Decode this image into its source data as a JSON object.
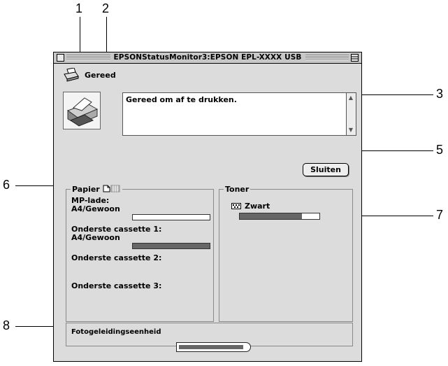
{
  "callouts": [
    "1",
    "2",
    "3",
    "5",
    "6",
    "7",
    "8"
  ],
  "window": {
    "title": "EPSONStatusMonitor3:EPSON EPL-XXXX USB"
  },
  "status": {
    "heading": "Gereed",
    "message": "Gereed om af te drukken."
  },
  "close_button": "Sluiten",
  "paper": {
    "group_label": "Papier",
    "trays": [
      {
        "name": "MP-lade:",
        "media": "A4/Gewoon",
        "level": 0.0
      },
      {
        "name": "Onderste cassette 1:",
        "media": "A4/Gewoon",
        "level": 1.0
      },
      {
        "name": "Onderste cassette 2:",
        "media": "",
        "level": null
      },
      {
        "name": "Onderste cassette 3:",
        "media": "",
        "level": null
      }
    ]
  },
  "toner": {
    "group_label": "Toner",
    "color_name": "Zwart",
    "level": 0.78
  },
  "photoconductor": {
    "label": "Fotogeleidingseenheid",
    "level": 0.95
  },
  "colors": {
    "window_bg": "#dcdcdc",
    "bar_fill": "#666666"
  },
  "icons": [
    "printer-status-icon",
    "printer-image-icon",
    "paper-icon",
    "toner-icon",
    "scroll-up-arrow-icon",
    "scroll-down-arrow-icon"
  ]
}
